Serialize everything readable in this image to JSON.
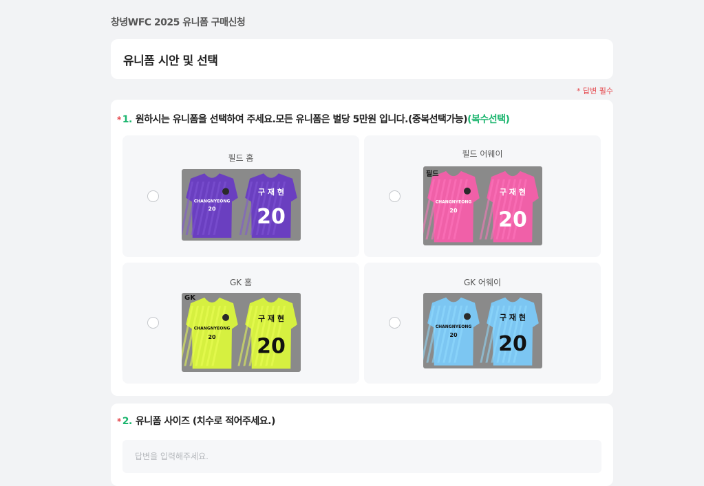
{
  "form": {
    "title": "창녕WFC 2025 유니폼 구매신청",
    "section_title": "유니폼 시안 및 선택",
    "required_note": "* 답변 필수"
  },
  "q1": {
    "asterisk": "*",
    "number": "1.",
    "text": "원하시는 유니폼을 선택하여 주세요.모든 유니폼은 벌당 5만원 입니다.(중복선택가능)",
    "extra": "(복수선택)",
    "options": [
      {
        "label": "필드 홈",
        "color": "#6a3fc0",
        "tag": "",
        "name_text": "구 재 현",
        "number": "20",
        "club_text": "CHANGNYEONG"
      },
      {
        "label": "필드 어웨이",
        "color": "#f060a8",
        "tag": "필드",
        "name_text": "구 재 현",
        "number": "20",
        "club_text": "CHANGNYEONG"
      },
      {
        "label": "GK 홈",
        "color": "#d6f040",
        "tag": "GK",
        "name_text": "구 재 현",
        "number": "20",
        "club_text": "CHANGNYEONG"
      },
      {
        "label": "GK 어웨이",
        "color": "#7cc6f2",
        "tag": "",
        "name_text": "구 재 현",
        "number": "20",
        "club_text": "CHANGNYEONG"
      }
    ]
  },
  "q2": {
    "asterisk": "*",
    "number": "2.",
    "text": "유니폼 사이즈 (치수로 적어주세요.)",
    "placeholder": "답변을 입력해주세요."
  }
}
